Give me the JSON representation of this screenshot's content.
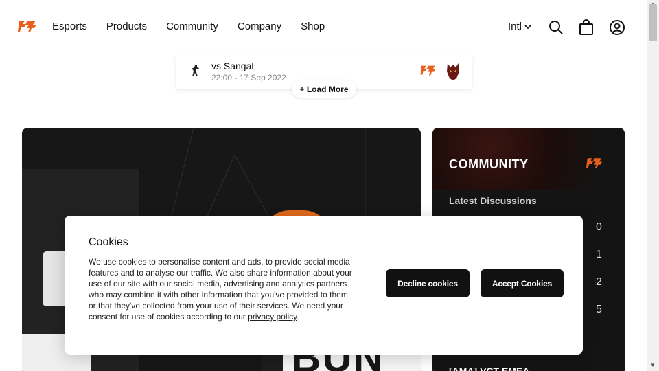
{
  "nav": {
    "links": [
      "Esports",
      "Products",
      "Community",
      "Company",
      "Shop"
    ],
    "lang": "Intl",
    "icons": [
      "search-icon",
      "bag-icon",
      "account-icon"
    ],
    "brand_color": "#e8601c"
  },
  "match": {
    "opponent": "vs Sangal",
    "time": "22:00 - 17 Sep 2022",
    "load_more": "+ Load More"
  },
  "hero": {
    "text": "BUN"
  },
  "community": {
    "title": "COMMUNITY",
    "subtitle": "Latest Discussions",
    "rows": [
      {
        "icon": "star-icon",
        "count": "0"
      },
      {
        "icon": "fnatic-icon",
        "count": "1"
      },
      {
        "icon": "megaphone-icon",
        "count": "2"
      },
      {
        "icon": "chat-icon",
        "count": "5"
      }
    ],
    "bottom_item": "[AMA] VCT EMEA"
  },
  "cookie": {
    "title": "Cookies",
    "body": "We use cookies to personalise content and ads, to provide social media features and to analyse our traffic. We also share information about your use of our site with our social media, advertising and analytics partners who may combine it with other information that you've provided to them or that they've collected from your use of their services. We need your consent for use of cookies according to our ",
    "link": "privacy policy",
    "body_end": ".",
    "decline": "Decline cookies",
    "accept": "Accept Cookies"
  }
}
